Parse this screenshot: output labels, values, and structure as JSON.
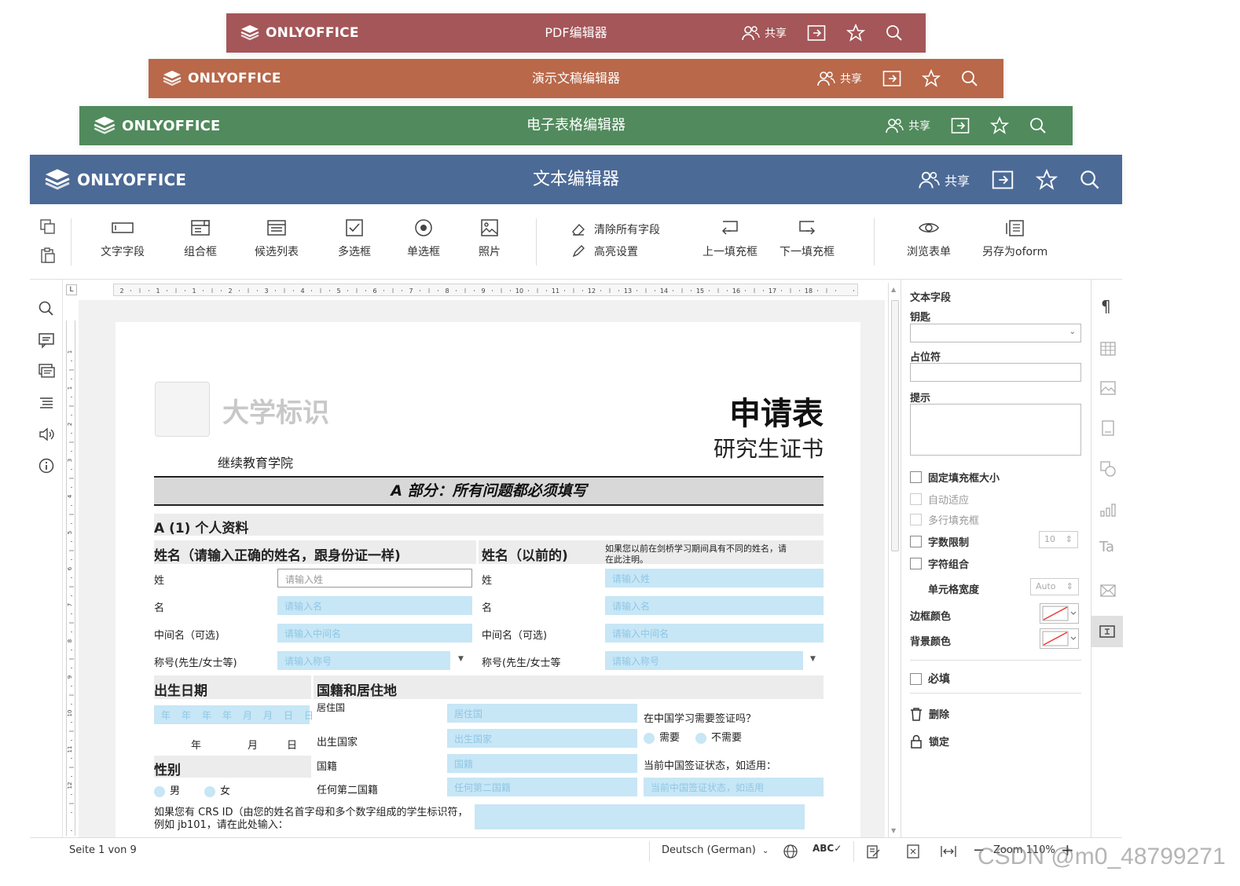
{
  "brand": "ONLYOFFICE",
  "headers": {
    "pdf": {
      "title": "PDF编辑器",
      "color": "#a45658"
    },
    "presentation": {
      "title": "演示文稿编辑器",
      "color": "#b9684a"
    },
    "spreadsheet": {
      "title": "电子表格编辑器",
      "color": "#518a5c"
    },
    "document": {
      "title": "文本编辑器",
      "color": "#4c6a96"
    },
    "share_label": "共享"
  },
  "toolbar": {
    "text_field": "文字字段",
    "combo_box": "组合框",
    "dropdown_list": "候选列表",
    "checkbox": "多选框",
    "radio": "单选框",
    "image": "照片",
    "clear_all_fields": "清除所有字段",
    "highlight_settings": "高亮设置",
    "prev_field": "上一填充框",
    "next_field": "下一填充框",
    "view_form": "浏览表单",
    "save_as_oform": "另存为oform"
  },
  "ruler": {
    "labels": [
      "2",
      "1",
      "1",
      "2",
      "3",
      "4",
      "5",
      "6",
      "7",
      "8",
      "9",
      "10",
      "11",
      "12",
      "13",
      "14",
      "15",
      "16",
      "17",
      "18"
    ]
  },
  "vruler": {
    "labels": [
      "1",
      "1",
      "2",
      "3",
      "4",
      "5",
      "6",
      "7",
      "8",
      "9",
      "10",
      "11",
      "12"
    ]
  },
  "form": {
    "logo_placeholder": "大学标识",
    "school": "继续教育学院",
    "title": "申请表",
    "subtitle": "研究生证书",
    "section_a": "A 部分：所有问题都必须填写",
    "personal": "A (1) 个人资料",
    "name_heading": "姓名（请输入正确的姓名，跟身份证一样)",
    "prev_name_heading": "姓名（以前的)",
    "prev_name_note_1": "如果您以前在剑桥学习期间具有不同的姓名，请",
    "prev_name_note_2": "在此注明。",
    "rows": [
      {
        "label": "姓",
        "placeholder": "请输入姓",
        "prev_label": "姓",
        "prev_placeholder": "请输入姓"
      },
      {
        "label": "名",
        "placeholder": "请输入名",
        "prev_label": "名",
        "prev_placeholder": "请输入名"
      },
      {
        "label": "中间名（可选)",
        "placeholder": "请输入中间名",
        "prev_label": "中间名（可选)",
        "prev_placeholder": "请输入中间名"
      },
      {
        "label": "称号(先生/女士等)",
        "placeholder": "请输入称号",
        "prev_label": "称号(先生/女士等",
        "prev_placeholder": "请输入称号"
      }
    ],
    "dob_heading": "出生日期",
    "dob_placeholder": "年　年　年　年　月　月　日　日",
    "dob_year": "年",
    "dob_month": "月",
    "dob_day": "日",
    "nationality_heading": "国籍和居住地",
    "residence_label": "居住国",
    "residence_placeholder": "居住国",
    "birth_country_label": "出生国家",
    "birth_country_placeholder": "出生国家",
    "nationality_label": "国籍",
    "nationality_placeholder": "国籍",
    "second_nationality_label": "任何第二国籍",
    "second_nationality_placeholder": "任何第二国籍",
    "visa_question": "在中国学习需要签证吗？",
    "visa_yes": "需要",
    "visa_no": "不需要",
    "visa_status_label": "当前中国签证状态，如适用：",
    "visa_status_placeholder": "当前中国签证状态，如适用",
    "gender_heading": "性别",
    "male": "男",
    "female": "女",
    "crs_note_1": "如果您有 CRS ID（由您的姓名首字母和多个数字组成的学生标识符，",
    "crs_note_2": "例如 jb101，请在此处输入："
  },
  "panel": {
    "title": "文本字段",
    "key_label": "钥匙",
    "placeholder_label": "占位符",
    "tip_label": "提示",
    "fixed_size": "固定填充框大小",
    "autofit": "自动适应",
    "multiline": "多行填充框",
    "char_limit": "字数限制",
    "char_limit_value": "10",
    "comb": "字符组合",
    "cell_width": "单元格宽度",
    "cell_width_value": "Auto",
    "border_color": "边框颜色",
    "bg_color": "背景颜色",
    "required": "必填",
    "delete": "删除",
    "lock": "锁定"
  },
  "status": {
    "page": "Seite 1 von 9",
    "language": "Deutsch (German)",
    "zoom": "Zoom 110%"
  },
  "watermark": "CSDN @m0_48799271"
}
